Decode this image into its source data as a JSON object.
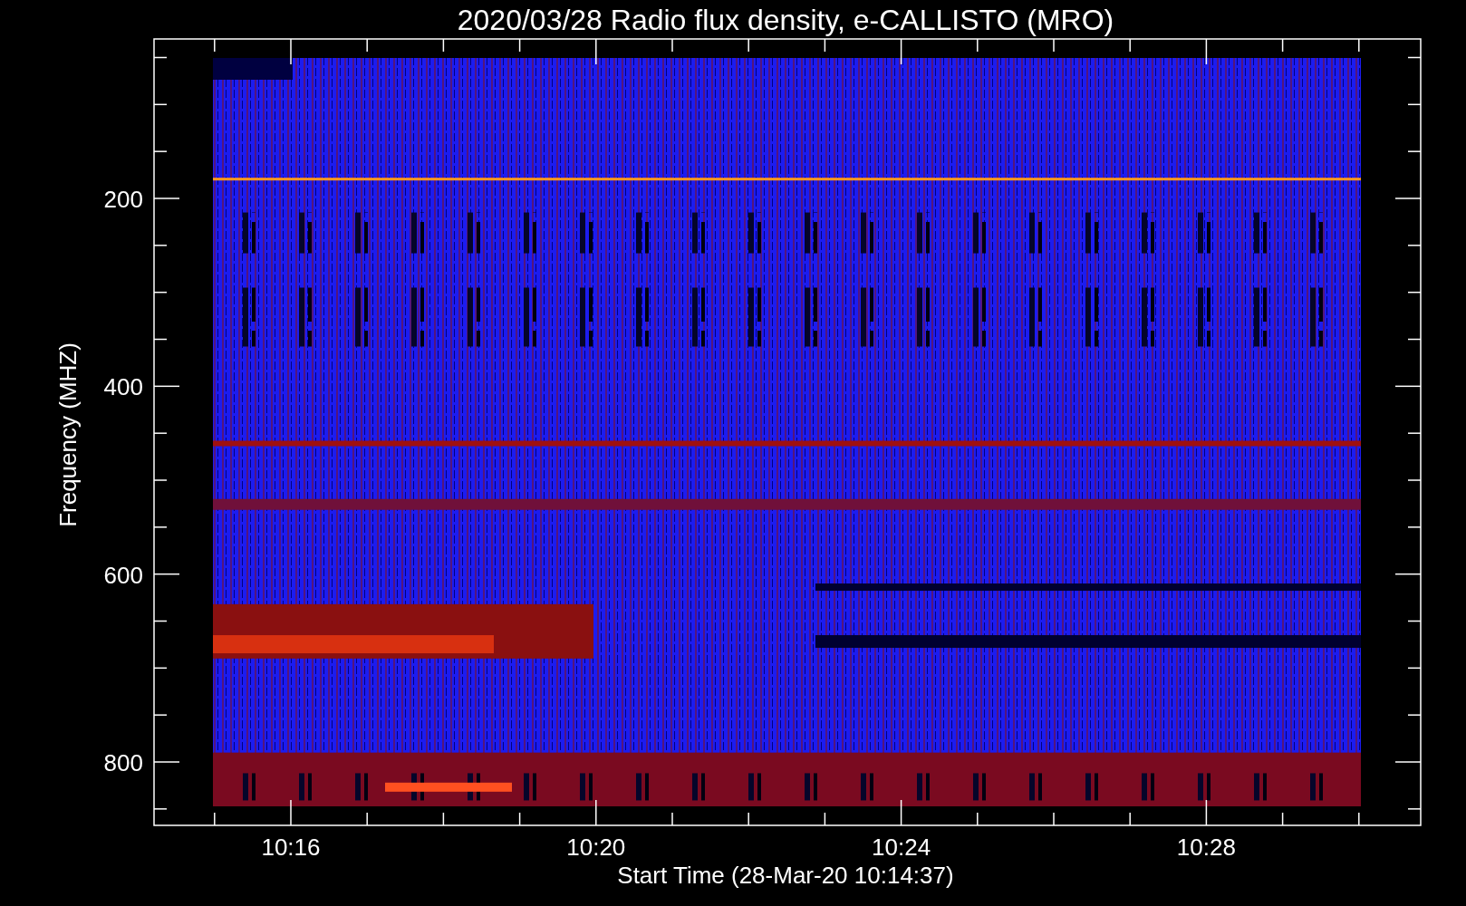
{
  "title": "2020/03/28  Radio flux density, e-CALLISTO (MRO)",
  "y_axis": {
    "label": "Frequency (MHZ)",
    "ticks": [
      "200",
      "400",
      "600",
      "800"
    ]
  },
  "x_axis": {
    "label": "Start Time (28-Mar-20 10:14:37)",
    "ticks": [
      "10:16",
      "10:20",
      "10:24",
      "10:28"
    ]
  }
}
